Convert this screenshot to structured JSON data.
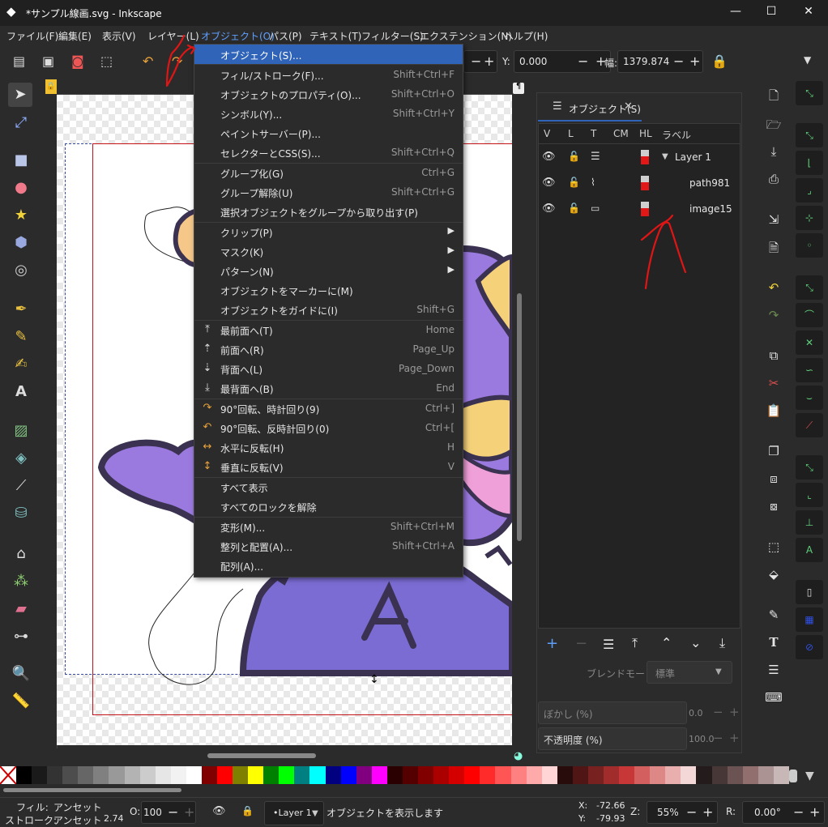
{
  "window": {
    "title": "*サンプル線画.svg - Inkscape"
  },
  "menubar": [
    "ファイル(F)",
    "編集(E)",
    "表示(V)",
    "レイヤー(L)",
    "オブジェクト(O)",
    "パス(P)",
    "テキスト(T)",
    "フィルター(S)",
    "エクステンション(N)",
    "ヘルプ(H)"
  ],
  "controls": {
    "y_label": "Y:",
    "y_value": "0.000",
    "w_label": "幅:",
    "w_value": "1379.874"
  },
  "object_menu": [
    {
      "label": "オブジェクト(S)...",
      "shortcut": ""
    },
    {
      "label": "フィル/ストローク(F)...",
      "shortcut": "Shift+Ctrl+F"
    },
    {
      "label": "オブジェクトのプロパティ(O)...",
      "shortcut": "Shift+Ctrl+O"
    },
    {
      "label": "シンボル(Y)...",
      "shortcut": "Shift+Ctrl+Y"
    },
    {
      "label": "ペイントサーバー(P)...",
      "shortcut": ""
    },
    {
      "label": "セレクターとCSS(S)...",
      "shortcut": "Shift+Ctrl+Q"
    },
    {
      "label": "グループ化(G)",
      "shortcut": "Ctrl+G"
    },
    {
      "label": "グループ解除(U)",
      "shortcut": "Shift+Ctrl+G"
    },
    {
      "label": "選択オブジェクトをグループから取り出す(P)",
      "shortcut": ""
    },
    {
      "label": "クリップ(P)",
      "shortcut": ""
    },
    {
      "label": "マスク(K)",
      "shortcut": ""
    },
    {
      "label": "パターン(N)",
      "shortcut": ""
    },
    {
      "label": "オブジェクトをマーカーに(M)",
      "shortcut": ""
    },
    {
      "label": "オブジェクトをガイドに(I)",
      "shortcut": "Shift+G"
    },
    {
      "label": "最前面へ(T)",
      "shortcut": "Home"
    },
    {
      "label": "前面へ(R)",
      "shortcut": "Page_Up"
    },
    {
      "label": "背面へ(L)",
      "shortcut": "Page_Down"
    },
    {
      "label": "最背面へ(B)",
      "shortcut": "End"
    },
    {
      "label": "90°回転、時計回り(9)",
      "shortcut": "Ctrl+]"
    },
    {
      "label": "90°回転、反時計回り(0)",
      "shortcut": "Ctrl+["
    },
    {
      "label": "水平に反転(H)",
      "shortcut": "H"
    },
    {
      "label": "垂直に反転(V)",
      "shortcut": "V"
    },
    {
      "label": "すべて表示",
      "shortcut": ""
    },
    {
      "label": "すべてのロックを解除",
      "shortcut": ""
    },
    {
      "label": "変形(M)...",
      "shortcut": "Shift+Ctrl+M"
    },
    {
      "label": "整列と配置(A)...",
      "shortcut": "Shift+Ctrl+A"
    },
    {
      "label": "配列(A)...",
      "shortcut": ""
    }
  ],
  "objects_panel": {
    "tab_label": "オブジェクト(S)",
    "columns": [
      "V",
      "L",
      "T",
      "CM",
      "HL",
      "ラベル"
    ],
    "rows": [
      {
        "label": "Layer 1"
      },
      {
        "label": "path981"
      },
      {
        "label": "image15"
      }
    ],
    "blend_label": "ブレンドモード:",
    "blend_value": "標準",
    "blur_label": "ぼかし (%)",
    "blur_value": "0.0",
    "opacity_label": "不透明度 (%)",
    "opacity_value": "100.0"
  },
  "status": {
    "fill_label": "フィル:",
    "fill_value": "アンセット",
    "stroke_label": "ストローク:",
    "stroke_value": "アンセット",
    "stroke_width": "2.74",
    "o_label": "O:",
    "o_value": "100",
    "layer": "•Layer 1",
    "message": "オブジェクトを表示します",
    "x_label": "X:",
    "x_value": "-72.66",
    "y_label": "Y:",
    "y_value": "-79.93",
    "z_label": "Z:",
    "zoom": "55%",
    "r_label": "R:",
    "rotation": "0.00°"
  },
  "palette": [
    "#000000",
    "#1a1a1a",
    "#333333",
    "#4d4d4d",
    "#666666",
    "#808080",
    "#999999",
    "#b3b3b3",
    "#cccccc",
    "#e6e6e6",
    "#f2f2f2",
    "#ffffff",
    "#800000",
    "#ff0000",
    "#808000",
    "#ffff00",
    "#008000",
    "#00ff00",
    "#008080",
    "#00ffff",
    "#000080",
    "#0000ff",
    "#800080",
    "#ff00ff",
    "#2b0000",
    "#550000",
    "#800000",
    "#aa0000",
    "#d40000",
    "#ff0000",
    "#ff2a2a",
    "#ff5555",
    "#ff8080",
    "#ffaaaa",
    "#ffd5d5",
    "#280b0b",
    "#501616",
    "#782121",
    "#a02c2c",
    "#c83737",
    "#d35f5f",
    "#de8787",
    "#e9afaf",
    "#f4d7d7",
    "#241c1c",
    "#483737",
    "#6c5353",
    "#916f6f",
    "#ac9393",
    "#c8b7b7"
  ]
}
